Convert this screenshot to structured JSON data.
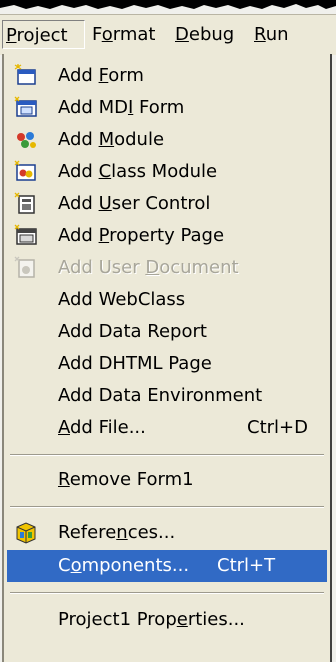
{
  "menubar": {
    "items": [
      {
        "label": "Project",
        "mnemonic": "P",
        "active": true
      },
      {
        "label": "Format",
        "mnemonic": "o",
        "active": false
      },
      {
        "label": "Debug",
        "mnemonic": "D",
        "active": false
      },
      {
        "label": "Run",
        "mnemonic": "R",
        "active": false
      }
    ]
  },
  "menu": {
    "items": [
      {
        "label": "Add Form",
        "mnemonic": "F",
        "icon": "form-icon"
      },
      {
        "label": "Add MDI Form",
        "mnemonic": "I",
        "icon": "mdi-form-icon"
      },
      {
        "label": "Add Module",
        "mnemonic": "M",
        "icon": "module-icon"
      },
      {
        "label": "Add Class Module",
        "mnemonic": "C",
        "icon": "class-module-icon"
      },
      {
        "label": "Add User Control",
        "mnemonic": "U",
        "icon": "user-control-icon"
      },
      {
        "label": "Add Property Page",
        "mnemonic": "P",
        "icon": "property-page-icon"
      },
      {
        "label": "Add User Document",
        "mnemonic": "D",
        "icon": "user-document-icon",
        "disabled": true
      },
      {
        "label": "Add WebClass"
      },
      {
        "label": "Add Data Report"
      },
      {
        "label": "Add DHTML Page"
      },
      {
        "label": "Add Data Environment"
      },
      {
        "label": "Add File...",
        "mnemonic": "A",
        "shortcut": "Ctrl+D"
      },
      {
        "label": "Remove Form1",
        "mnemonic": "R"
      },
      {
        "label": "References...",
        "mnemonic": "n",
        "icon": "references-icon"
      },
      {
        "label": "Components...",
        "mnemonic": "o",
        "shortcut": "Ctrl+T",
        "selected": true
      },
      {
        "label": "Project1 Properties...",
        "mnemonic": "e"
      }
    ]
  },
  "colors": {
    "menu_bg": "#ece9d8",
    "highlight": "#316ac5",
    "disabled_text": "#a8a69a"
  }
}
